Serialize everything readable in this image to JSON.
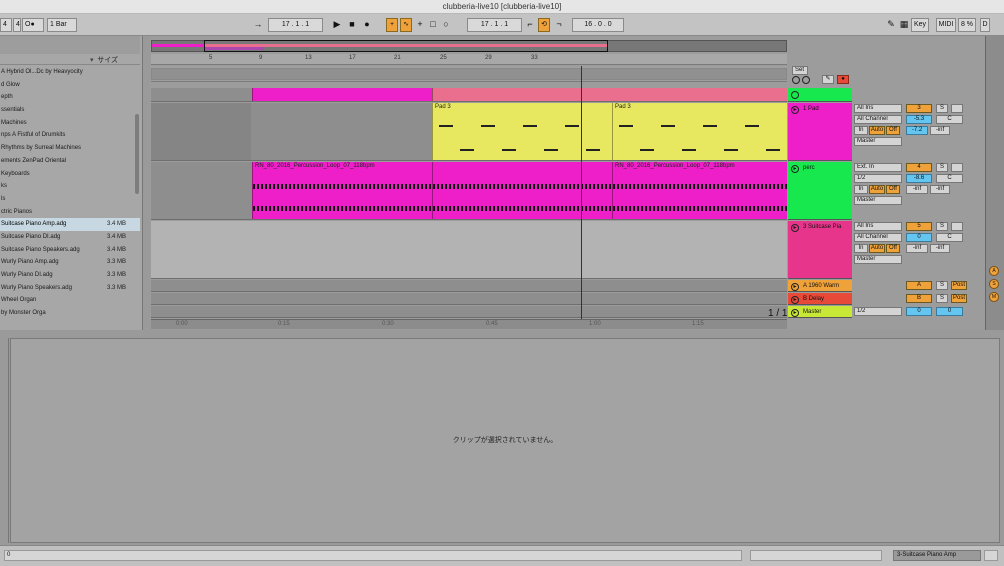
{
  "window": {
    "title": "clubberia-live10 [clubberia-live10]"
  },
  "controlbar": {
    "left_items": [
      "4",
      "4",
      "O●",
      "1 Bar"
    ],
    "position": "17 . 1 . 1",
    "loop_start": "17 . 1 . 1",
    "loop_length": "16 . 0 . 0",
    "key_label": "Key",
    "midi_label": "MIDI",
    "cpu": "8 %",
    "d_label": "D"
  },
  "browser": {
    "size_header": "サイズ",
    "items": [
      {
        "name": "A Hybrid Ol...Dc by Heavyocity",
        "size": ""
      },
      {
        "name": "d Glow",
        "size": ""
      },
      {
        "name": "epth",
        "size": ""
      },
      {
        "name": "ssentials",
        "size": ""
      },
      {
        "name": "Machines",
        "size": ""
      },
      {
        "name": "nps A Fistful of Drumkits",
        "size": ""
      },
      {
        "name": "Rhythms by Surreal Machines",
        "size": ""
      },
      {
        "name": "ements ZenPad Oriental",
        "size": ""
      },
      {
        "name": "Keyboards",
        "size": ""
      },
      {
        "name": "ks",
        "size": ""
      },
      {
        "name": "ls",
        "size": ""
      },
      {
        "name": "ctric Pianos",
        "size": ""
      },
      {
        "name": "Suitcase Piano Amp.adg",
        "size": "3.4 MB",
        "selected": true
      },
      {
        "name": "Suitcase Piano DI.adg",
        "size": "3.4 MB"
      },
      {
        "name": "Suitcase Piano Speakers.adg",
        "size": "3.4 MB"
      },
      {
        "name": "Wurly Piano Amp.adg",
        "size": "3.3 MB"
      },
      {
        "name": "Wurly Piano DI.adg",
        "size": "3.3 MB"
      },
      {
        "name": "Wurly Piano Speakers.adg",
        "size": "3.3 MB"
      },
      {
        "name": "Wheel Organ",
        "size": ""
      },
      {
        "name": "by Monster Orga",
        "size": ""
      }
    ]
  },
  "ruler_ticks": [
    "5",
    "9",
    "13",
    "17",
    "21",
    "25",
    "29",
    "33"
  ],
  "beat_ticks": [
    "0:00",
    "0:15",
    "0:30",
    "0:45",
    "1:00",
    "1:15"
  ],
  "page_count": "1 / 1",
  "tracks": [
    {
      "name": "1 Pad",
      "input": "All Ins",
      "channel": "All Channel",
      "monitor": [
        "In",
        "Auto",
        "Off"
      ],
      "output": "Master",
      "number": "3",
      "solo": "S",
      "volume": "-5.3",
      "pan": "C",
      "vol2": "-7.2",
      "vol3": "-inf",
      "clips": [
        {
          "name": "Pad 3"
        },
        {
          "name": "Pad 3"
        }
      ]
    },
    {
      "name": "perc",
      "input": "Ext. In",
      "channel": "1/2",
      "monitor": [
        "In",
        "Auto",
        "Off"
      ],
      "output": "Master",
      "number": "4",
      "solo": "S",
      "volume": "-8.6",
      "pan": "C",
      "vol2": "-inf",
      "vol3": "-inf",
      "clips": [
        {
          "name": "RN_80_2016_Percussion_Loop_07_118bpm"
        },
        {
          "name": "RN_80_2016_Percussion_Loop_07_118bpm"
        }
      ]
    },
    {
      "name": "3 Suitcase Pia",
      "input": "All Ins",
      "channel": "All Channel",
      "monitor": [
        "In",
        "Auto",
        "Off"
      ],
      "output": "Master",
      "number": "5",
      "solo": "S",
      "volume": "0",
      "pan": "C",
      "vol2": "-inf",
      "vol3": "-inf",
      "clips": []
    }
  ],
  "returns": [
    {
      "name": "A 1960 Warm",
      "letter": "A",
      "solo": "S",
      "post": "Post"
    },
    {
      "name": "B Delay",
      "letter": "B",
      "solo": "S",
      "post": "Post"
    }
  ],
  "master": {
    "name": "Master",
    "output": "1/2",
    "vol": "0",
    "vol2": "0"
  },
  "right_panel": [
    "A",
    "S",
    "M"
  ],
  "detail": {
    "message": "クリップが選択されていません。"
  },
  "status": {
    "left_value": "0",
    "track_name": "3-Suitcase Piano Amp"
  },
  "colors": {
    "magenta": "#ee1fc8",
    "yellow": "#e7e860",
    "green": "#17e84d",
    "pink_clip": "#ea6e8e",
    "orange": "#f0a23a",
    "blue": "#64c6f0",
    "red": "#e84a3a"
  }
}
